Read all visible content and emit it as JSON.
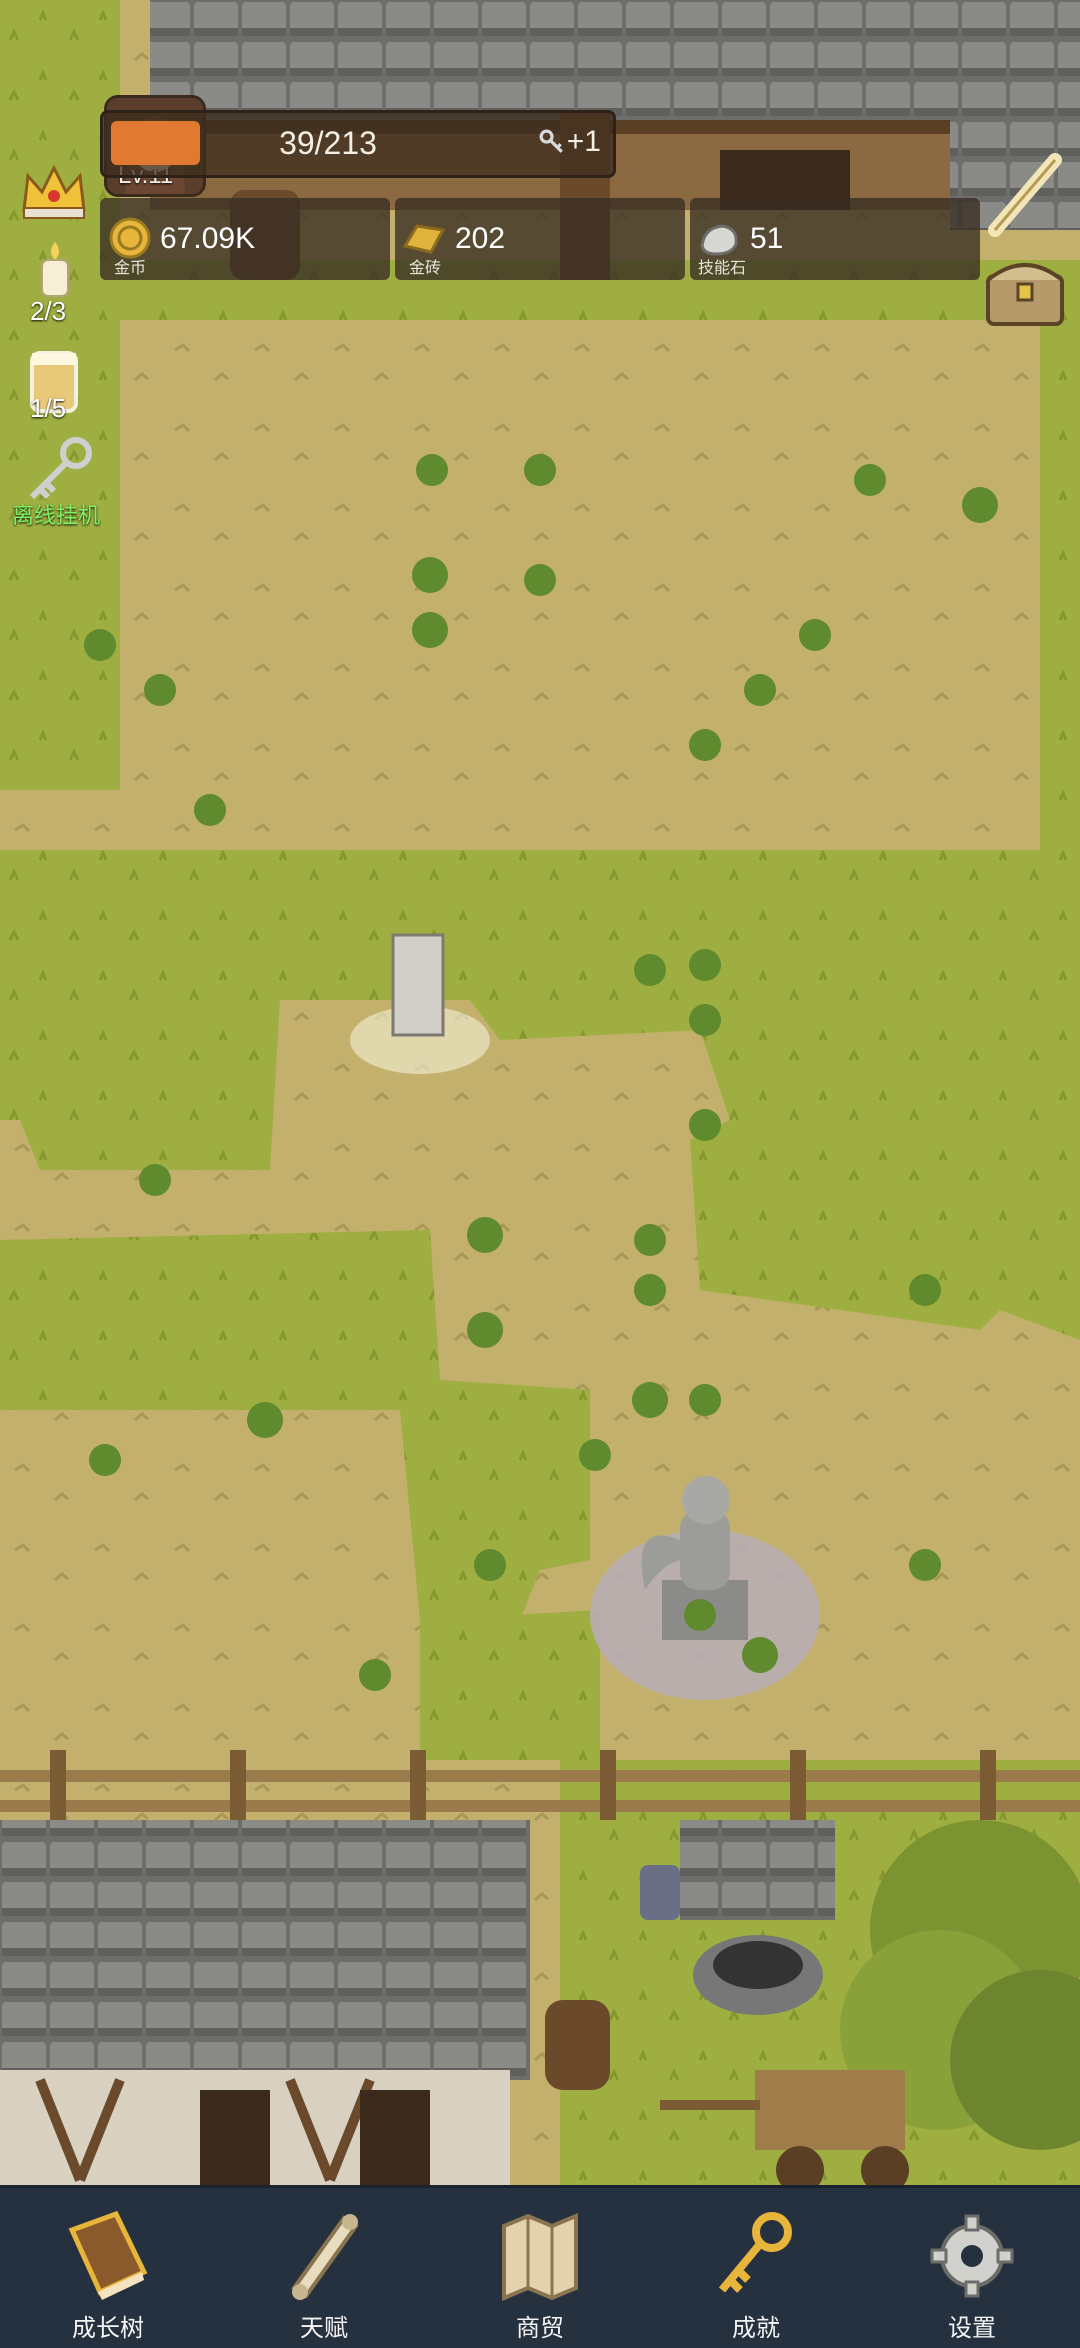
{
  "player": {
    "level": "Lv.11",
    "exp_text": "39/213",
    "exp_fraction": 0.18,
    "bonus": "+1"
  },
  "resources": {
    "gold": {
      "value": "67.09K",
      "label": "金币"
    },
    "gold_bar": {
      "value": "202",
      "label": "金砖"
    },
    "skill_stone": {
      "value": "51",
      "label": "技能石"
    }
  },
  "left_column": {
    "candle_count": "2/3",
    "drink_count": "1/5",
    "idle_label": "离线挂机"
  },
  "bottom_nav": {
    "items": [
      {
        "label": "成长树",
        "icon": "book-icon"
      },
      {
        "label": "天赋",
        "icon": "scroll-icon"
      },
      {
        "label": "商贸",
        "icon": "map-icon"
      },
      {
        "label": "成就",
        "icon": "key-icon"
      },
      {
        "label": "设置",
        "icon": "gear-icon"
      }
    ]
  },
  "colors": {
    "exp_fill": "#e07a31",
    "nav_bg": "#263140",
    "grass": "#9aaa3c",
    "dirt": "#bfae6a"
  }
}
